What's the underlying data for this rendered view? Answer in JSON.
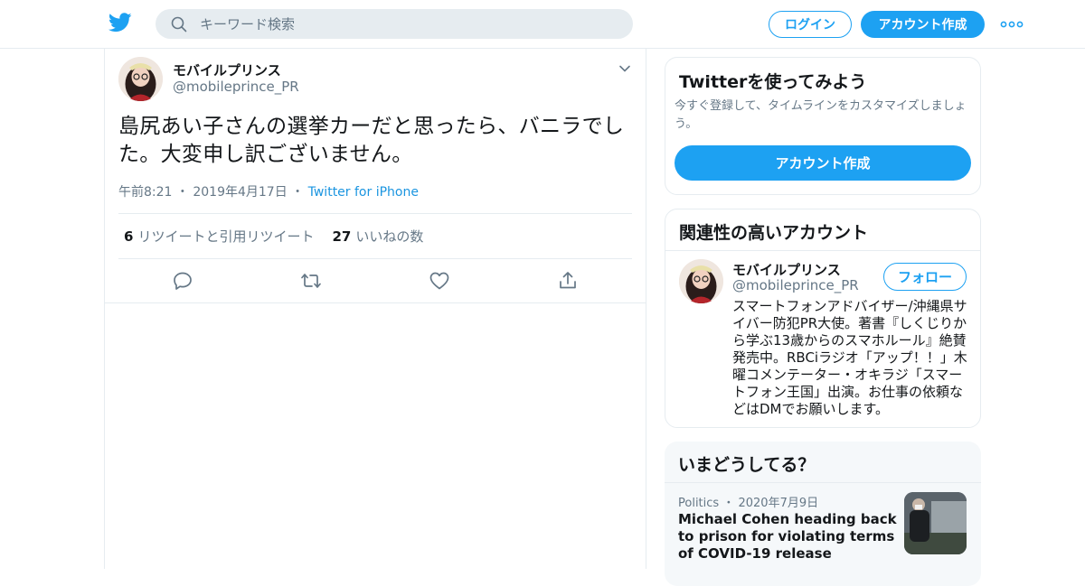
{
  "header": {
    "logo_icon": "twitter-bird-icon",
    "search_placeholder": "キーワード検索",
    "login_label": "ログイン",
    "signup_label": "アカウント作成",
    "more_icon": "more-dots-icon",
    "accent": "#1da1f2"
  },
  "tweet": {
    "name": "モバイルプリンス",
    "handle": "@mobileprince_PR",
    "text": "島尻あい子さんの選挙カーだと思ったら、バニラでした。大変申し訳ございません。",
    "time": "午前8:21",
    "date": "2019年4月17日",
    "sep": "・",
    "source": "Twitter for iPhone",
    "retweets_count": "6",
    "retweets_label": "リツイートと引用リツイート",
    "likes_count": "27",
    "likes_label": "いいねの数"
  },
  "signup_card": {
    "title": "Twitterを使ってみよう",
    "description": "今すぐ登録して、タイムラインをカスタマイズしましょう。",
    "button_label": "アカウント作成"
  },
  "related": {
    "title": "関連性の高いアカウント",
    "name": "モバイルプリンス",
    "handle": "@mobileprince_PR",
    "follow_label": "フォロー",
    "bio": "スマートフォンアドバイザー/沖縄県サイバー防犯PR大使。著書『しくじりから学ぶ13歳からのスマホルール』絶賛発売中。RBCiラジオ「アップ！！」木曜コメンテーター・オキラジ「スマートフォン王国」出演。お仕事の依頼などはDMでお願いします。"
  },
  "trends": {
    "title": "いまどうしてる？",
    "category": "Politics",
    "sep": "・",
    "date": "2020年7月9日",
    "headline": "Michael Cohen heading back to prison for violating terms of COVID-19 release"
  }
}
